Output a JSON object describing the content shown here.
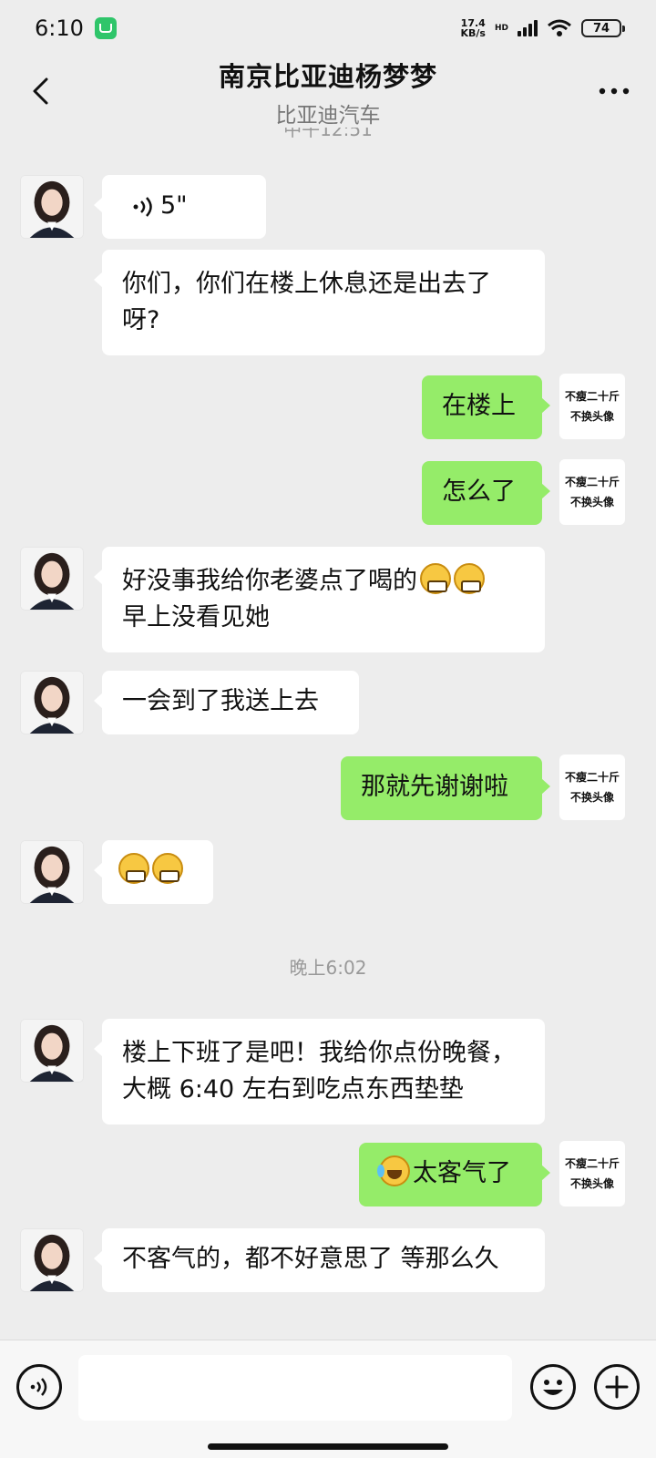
{
  "status_bar": {
    "time": "6:10",
    "net_speed_value": "17.4",
    "net_speed_unit": "KB/s",
    "network_tag": "HD",
    "battery": "74"
  },
  "header": {
    "title": "南京比亚迪杨梦梦",
    "subtitle": "比亚迪汽车"
  },
  "chat": {
    "time_labels": [
      "中午12:51",
      "晚上6:02"
    ],
    "my_avatar_text": [
      "不瘦二十斤",
      "不换头像"
    ],
    "messages": [
      {
        "side": "left",
        "type": "voice",
        "duration": "5\""
      },
      {
        "side": "left",
        "type": "text",
        "text": "你们，你们在楼上休息还是出去了呀?"
      },
      {
        "side": "right",
        "type": "text",
        "text": "在楼上"
      },
      {
        "side": "right",
        "type": "text",
        "text": "怎么了"
      },
      {
        "side": "left",
        "type": "text",
        "text": "好没事我给你老婆点了喝的",
        "line2": "早上没看见她",
        "emoji": "grin-emoji x2"
      },
      {
        "side": "left",
        "type": "text",
        "text": "一会到了我送上去"
      },
      {
        "side": "right",
        "type": "text",
        "text": "那就先谢谢啦"
      },
      {
        "side": "left",
        "type": "emoji",
        "emoji": "grin-emoji x2"
      },
      {
        "side": "left",
        "type": "text",
        "text": "楼上下班了是吧！我给你点份晚餐，",
        "line2": "大概 6:40 左右到吃点东西垫垫"
      },
      {
        "side": "right",
        "type": "text",
        "text": "太客气了",
        "emoji": "cry-laugh-emoji"
      },
      {
        "side": "left",
        "type": "text",
        "text": "不客气的，都不好意思了 等那么久"
      }
    ]
  },
  "input_bar": {
    "placeholder": ""
  },
  "colors": {
    "background": "#ededed",
    "my_bubble": "#95ec69",
    "their_bubble": "#ffffff"
  }
}
